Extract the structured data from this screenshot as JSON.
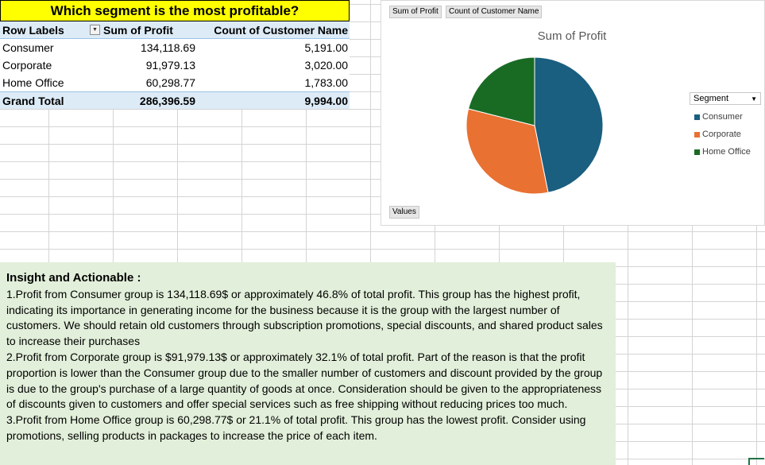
{
  "title": "Which segment is the most profitable?",
  "pivot": {
    "headers": {
      "row_labels": "Row Labels",
      "sum_profit": "Sum of Profit",
      "count_customer": "Count of Customer Name"
    },
    "rows": [
      {
        "label": "Consumer",
        "profit": "134,118.69",
        "count": "5,191.00"
      },
      {
        "label": "Corporate",
        "profit": "91,979.13",
        "count": "3,020.00"
      },
      {
        "label": "Home Office",
        "profit": "60,298.77",
        "count": "1,783.00"
      }
    ],
    "total": {
      "label": "Grand Total",
      "profit": "286,396.59",
      "count": "9,994.00"
    }
  },
  "chart": {
    "field_buttons": {
      "sum_profit": "Sum of Profit",
      "count_customer": "Count of Customer Name",
      "values": "Values"
    },
    "legend_title": "Segment",
    "colors": {
      "Consumer": "#1a5e80",
      "Corporate": "#e97132",
      "Home Office": "#196b24"
    }
  },
  "chart_data": {
    "type": "pie",
    "title": "Sum of Profit",
    "categories": [
      "Consumer",
      "Corporate",
      "Home Office"
    ],
    "values": [
      134118.69,
      91979.13,
      60298.77
    ],
    "legend": "right"
  },
  "insight": {
    "heading": "Insight and Actionable :",
    "p1": "1.Profit from Consumer group is 134,118.69$ or approximately 46.8% of total profit. This group has the highest profit, indicating its importance in generating income for the business because it is the group with the largest number of customers. We should retain old customers through subscription promotions, special discounts, and shared product sales to increase their purchases",
    "p2": "2.Profit from Corporate group is $91,979.13$ or approximately 32.1% of total profit. Part of the reason is that the profit proportion is lower than the Consumer group due to the smaller number of customers and discount provided by the group is due to the group's purchase of a large quantity of goods at once. Consideration should be given to the appropriateness of discounts given to customers and offer special services such as free shipping without reducing prices too much.",
    "p3": "3.Profit from Home Office group is 60,298.77$ or  21.1% of total profit. This group has the lowest profit. Consider using promotions, selling products in packages to increase the price of each item."
  }
}
